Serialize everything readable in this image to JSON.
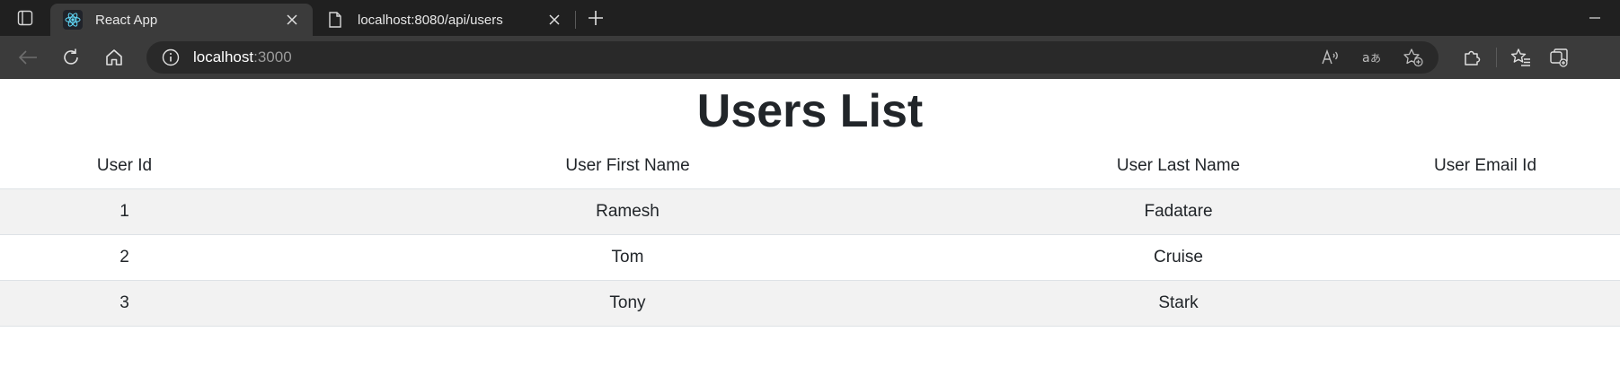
{
  "browser": {
    "tabs": [
      {
        "title": "React App",
        "active": true,
        "icon": "react-icon"
      },
      {
        "title": "localhost:8080/api/users",
        "active": false,
        "icon": "page-icon"
      }
    ],
    "address": {
      "host": "localhost",
      "port": ":3000"
    },
    "colors": {
      "tabstrip": "#202020",
      "toolbar": "#3b3b3b",
      "omnibox": "#292929"
    }
  },
  "page": {
    "title": "Users List",
    "table": {
      "headers": [
        "User Id",
        "User First Name",
        "User Last Name",
        "User Email Id"
      ],
      "rows": [
        {
          "id": "1",
          "first": "Ramesh",
          "last": "Fadatare",
          "email": ""
        },
        {
          "id": "2",
          "first": "Tom",
          "last": "Cruise",
          "email": ""
        },
        {
          "id": "3",
          "first": "Tony",
          "last": "Stark",
          "email": ""
        }
      ]
    }
  }
}
